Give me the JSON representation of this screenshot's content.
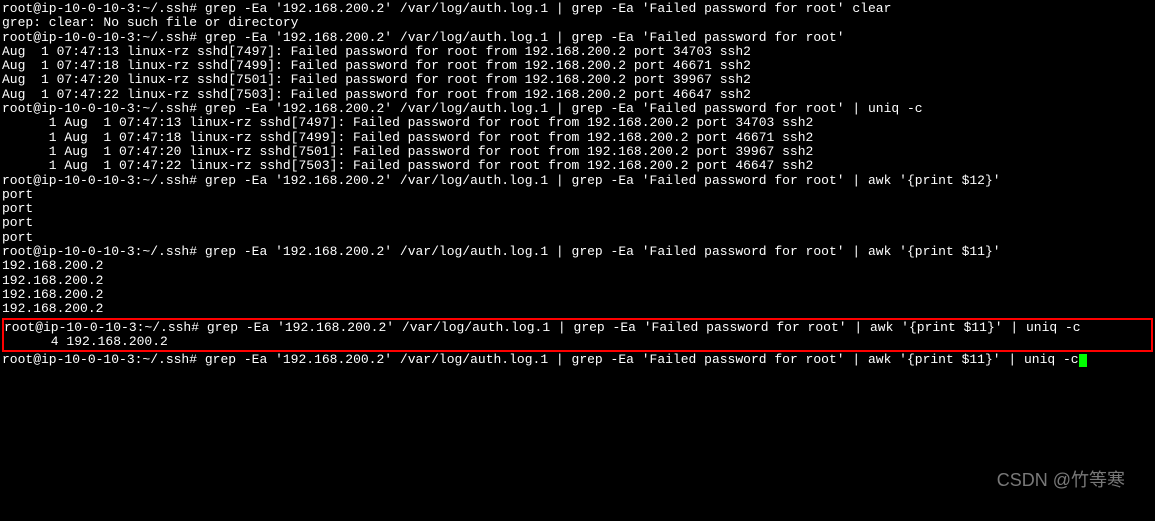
{
  "prompt": "root@ip-10-0-10-3:~/.ssh#",
  "commands": {
    "cmd1": "grep -Ea '192.168.200.2' /var/log/auth.log.1 | grep -Ea 'Failed password for root' clear",
    "cmd2": "grep -Ea '192.168.200.2' /var/log/auth.log.1 | grep -Ea 'Failed password for root'",
    "cmd3": "grep -Ea '192.168.200.2' /var/log/auth.log.1 | grep -Ea 'Failed password for root' | uniq -c",
    "cmd4": "grep -Ea '192.168.200.2' /var/log/auth.log.1 | grep -Ea 'Failed password for root' | awk '{print $12}'",
    "cmd5": "grep -Ea '192.168.200.2' /var/log/auth.log.1 | grep -Ea 'Failed password for root' | awk '{print $11}'",
    "cmd6": "grep -Ea '192.168.200.2' /var/log/auth.log.1 | grep -Ea 'Failed password for root' | awk '{print $11}' | uniq -c",
    "cmd7": "grep -Ea '192.168.200.2' /var/log/auth.log.1 | grep -Ea 'Failed password for root' | awk '{print $11}' | uniq -c"
  },
  "error": "grep: clear: No such file or directory",
  "log_lines": [
    "Aug  1 07:47:13 linux-rz sshd[7497]: Failed password for root from 192.168.200.2 port 34703 ssh2",
    "Aug  1 07:47:18 linux-rz sshd[7499]: Failed password for root from 192.168.200.2 port 46671 ssh2",
    "Aug  1 07:47:20 linux-rz sshd[7501]: Failed password for root from 192.168.200.2 port 39967 ssh2",
    "Aug  1 07:47:22 linux-rz sshd[7503]: Failed password for root from 192.168.200.2 port 46647 ssh2"
  ],
  "uniq_lines": [
    "      1 Aug  1 07:47:13 linux-rz sshd[7497]: Failed password for root from 192.168.200.2 port 34703 ssh2",
    "      1 Aug  1 07:47:18 linux-rz sshd[7499]: Failed password for root from 192.168.200.2 port 46671 ssh2",
    "      1 Aug  1 07:47:20 linux-rz sshd[7501]: Failed password for root from 192.168.200.2 port 39967 ssh2",
    "      1 Aug  1 07:47:22 linux-rz sshd[7503]: Failed password for root from 192.168.200.2 port 46647 ssh2"
  ],
  "port_output": [
    "port",
    "port",
    "port",
    "port"
  ],
  "ip_output": [
    "192.168.200.2",
    "192.168.200.2",
    "192.168.200.2",
    "192.168.200.2"
  ],
  "uniq_result": "      4 192.168.200.2",
  "watermark": "CSDN @竹等寒"
}
